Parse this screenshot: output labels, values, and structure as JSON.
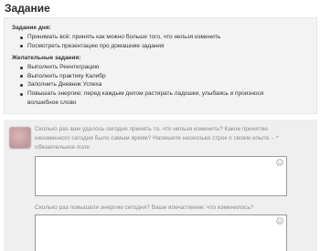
{
  "page": {
    "title": "Задание"
  },
  "task": {
    "daily_heading": "Задание дня:",
    "daily_items": [
      "Принимать всё: принять как можно больше того, что нельзя изменить",
      "Посмотреть презентацию про домашние задания"
    ],
    "optional_heading": "Желательные задания:",
    "optional_items": [
      "Выполнить Реинтеграцию",
      "Выполнить практику Калибр",
      "Заполнить Дневник Успеха",
      "Повышать энергию: перед каждым делом растирать ладошки, улыбаясь и произнося волшебное слово"
    ]
  },
  "questions": [
    {
      "text": "Сколько раз вам удалось сегодня принять то, что нельзя изменить? Какое принятие неизменного сегодня было самым ярким? Напишите несколько строк о своем опыте. - ",
      "required_note": "* обязательное поле",
      "answer": "",
      "emoji_icon": "smiley-icon"
    },
    {
      "text": "Сколько раз повышали энергию сегодня? Ваше впечатление: что изменилось?",
      "answer": "",
      "emoji_icon": "smiley-icon"
    }
  ],
  "colors": {
    "card_background": "#f3f3f3",
    "qa_background": "#efefef",
    "question_text": "#8a8a8a",
    "input_border": "#9a9a9a"
  }
}
